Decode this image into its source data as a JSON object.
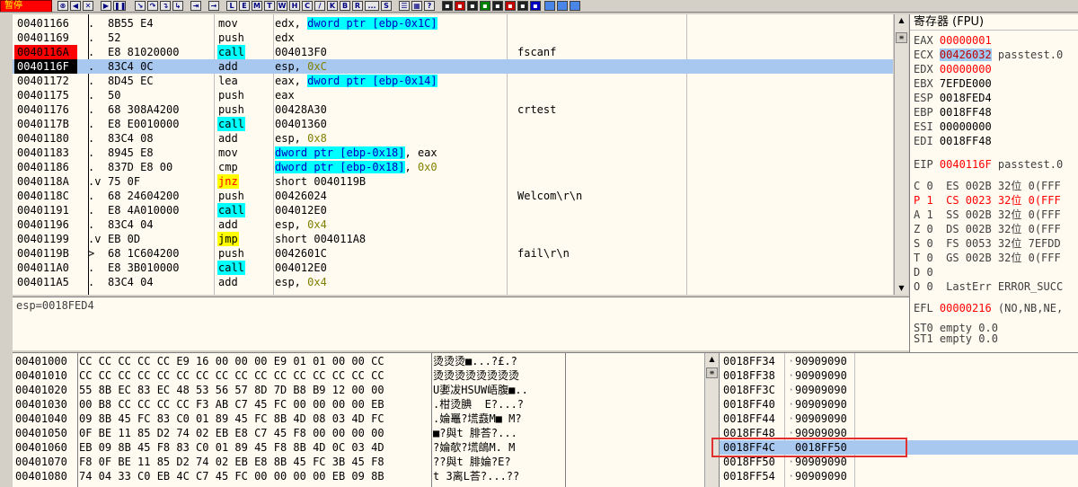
{
  "toolbar": {
    "status": "暂停",
    "buttons": [
      "L",
      "E",
      "M",
      "T",
      "W",
      "H",
      "C",
      "/",
      "K",
      "B",
      "R",
      "...",
      "S"
    ]
  },
  "disasm": {
    "rows": [
      {
        "addr": "00401166",
        "mark": ".",
        "hex": "8B55 E4",
        "mn": "mov",
        "op": "edx, dword ptr [ebp-0x1C]",
        "cm": "",
        "style": ""
      },
      {
        "addr": "00401169",
        "mark": ".",
        "hex": "52",
        "mn": "push",
        "op": "edx",
        "cm": "",
        "style": ""
      },
      {
        "addr": "0040116A",
        "mark": ".",
        "hex": "E8 81020000",
        "mn": "call",
        "op": "004013F0",
        "cm": "fscanf",
        "style": "bp"
      },
      {
        "addr": "0040116F",
        "mark": ".",
        "hex": "83C4 0C",
        "mn": "add",
        "op": "esp, 0xC",
        "cm": "",
        "style": "cur"
      },
      {
        "addr": "00401172",
        "mark": ".",
        "hex": "8D45 EC",
        "mn": "lea",
        "op": "eax, dword ptr [ebp-0x14]",
        "cm": "",
        "style": ""
      },
      {
        "addr": "00401175",
        "mark": ".",
        "hex": "50",
        "mn": "push",
        "op": "eax",
        "cm": "",
        "style": ""
      },
      {
        "addr": "00401176",
        "mark": ".",
        "hex": "68 308A4200",
        "mn": "push",
        "op": "00428A30",
        "cm": "crtest",
        "style": ""
      },
      {
        "addr": "0040117B",
        "mark": ".",
        "hex": "E8 E0010000",
        "mn": "call",
        "op": "00401360",
        "cm": "",
        "style": ""
      },
      {
        "addr": "00401180",
        "mark": ".",
        "hex": "83C4 08",
        "mn": "add",
        "op": "esp, 0x8",
        "cm": "",
        "style": ""
      },
      {
        "addr": "00401183",
        "mark": ".",
        "hex": "8945 E8",
        "mn": "mov",
        "op": "dword ptr [ebp-0x18], eax",
        "cm": "",
        "style": ""
      },
      {
        "addr": "00401186",
        "mark": ".",
        "hex": "837D E8 00",
        "mn": "cmp",
        "op": "dword ptr [ebp-0x18], 0x0",
        "cm": "",
        "style": ""
      },
      {
        "addr": "0040118A",
        "mark": ".v",
        "hex": "75 0F",
        "mn": "jnz",
        "op": "short 0040119B",
        "cm": "",
        "style": ""
      },
      {
        "addr": "0040118C",
        "mark": ".",
        "hex": "68 24604200",
        "mn": "push",
        "op": "00426024",
        "cm": "Welcom\\r\\n",
        "style": ""
      },
      {
        "addr": "00401191",
        "mark": ".",
        "hex": "E8 4A010000",
        "mn": "call",
        "op": "004012E0",
        "cm": "",
        "style": ""
      },
      {
        "addr": "00401196",
        "mark": ".",
        "hex": "83C4 04",
        "mn": "add",
        "op": "esp, 0x4",
        "cm": "",
        "style": ""
      },
      {
        "addr": "00401199",
        "mark": ".v",
        "hex": "EB 0D",
        "mn": "jmp",
        "op": "short 004011A8",
        "cm": "",
        "style": ""
      },
      {
        "addr": "0040119B",
        "mark": ">",
        "hex": "68 1C604200",
        "mn": "push",
        "op": "0042601C",
        "cm": "fail\\r\\n",
        "style": ""
      },
      {
        "addr": "004011A0",
        "mark": ".",
        "hex": "E8 3B010000",
        "mn": "call",
        "op": "004012E0",
        "cm": "",
        "style": ""
      },
      {
        "addr": "004011A5",
        "mark": ".",
        "hex": "83C4 04",
        "mn": "add",
        "op": "esp, 0x4",
        "cm": "",
        "style": ""
      }
    ]
  },
  "info": {
    "text": "esp=0018FED4"
  },
  "registers": {
    "title": "寄存器 (FPU)",
    "general": [
      {
        "name": "EAX",
        "value": "00000001",
        "extra": "",
        "changed": true
      },
      {
        "name": "ECX",
        "value": "00426032",
        "extra": "passtest.0",
        "changed": true
      },
      {
        "name": "EDX",
        "value": "00000000",
        "extra": "",
        "changed": true
      },
      {
        "name": "EBX",
        "value": "7EFDE000",
        "extra": "",
        "changed": false
      },
      {
        "name": "ESP",
        "value": "0018FED4",
        "extra": "",
        "changed": false
      },
      {
        "name": "EBP",
        "value": "0018FF48",
        "extra": "",
        "changed": false
      },
      {
        "name": "ESI",
        "value": "00000000",
        "extra": "",
        "changed": false
      },
      {
        "name": "EDI",
        "value": "0018FF48",
        "extra": "",
        "changed": false
      }
    ],
    "eip": {
      "name": "EIP",
      "value": "0040116F",
      "extra": "passtest.0"
    },
    "flags": [
      "C 0  ES 002B 32位 0(FFF",
      "P 1  CS 0023 32位 0(FFF",
      "A 1  SS 002B 32位 0(FFF",
      "Z 0  DS 002B 32位 0(FFF",
      "S 0  FS 0053 32位 7EFDD",
      "T 0  GS 002B 32位 0(FFF",
      "D 0",
      "O 0  LastErr ERROR_SUCC"
    ],
    "efl": {
      "name": "EFL",
      "value": "00000216",
      "extra": "(NO,NB,NE,"
    },
    "st": [
      "ST0 empty 0.0",
      "ST1 empty 0.0"
    ]
  },
  "dump": {
    "rows": [
      {
        "addr": "00401000",
        "hex": "CC CC CC CC CC E9 16 00 00 00 E9 01 01 00 00 CC",
        "ascii": "烫烫烫■...?£.?"
      },
      {
        "addr": "00401010",
        "hex": "CC CC CC CC CC CC CC CC CC CC CC CC CC CC CC CC",
        "ascii": "烫烫烫烫烫烫烫烫"
      },
      {
        "addr": "00401020",
        "hex": "55 8B EC 83 EC 48 53 56 57 8D 7D B8 B9 12 00 00",
        "ascii": "U嬱冹HSUW峿腹■.."
      },
      {
        "addr": "00401030",
        "hex": "00 B8 CC CC CC CC F3 AB C7 45 FC 00 00 00 00 EB",
        "ascii": ".柑烫腆  E?...?"
      },
      {
        "addr": "00401040",
        "hex": "09 8B 45 FC 83 C0 01 89 45 FC 8B 4D 08 03 4D FC",
        "ascii": ".婨鼉?塃鼖M■ M?"
      },
      {
        "addr": "00401050",
        "hex": "0F BE 11 85 D2 74 02 EB E8 C7 45 F8 00 00 00 00",
        "ascii": "■?與t 腓荅?..."
      },
      {
        "addr": "00401060",
        "hex": "EB 09 8B 45 F8 83 C0 01 89 45 F8 8B 4D 0C 03 4D",
        "ascii": "?婨欹?塃鴭M. M"
      },
      {
        "addr": "00401070",
        "hex": "F8 0F BE 11 85 D2 74 02 EB E8 8B 45 FC 3B 45 F8",
        "ascii": "??與t 腓婨?E?"
      },
      {
        "addr": "00401080",
        "hex": "74 04 33 C0 EB 4C C7 45 FC 00 00 00 00 EB 09 8B",
        "ascii": "t 3离L荅?...??"
      }
    ]
  },
  "stack": {
    "rows": [
      {
        "addr": "0018FF34",
        "value": "90909090"
      },
      {
        "addr": "0018FF38",
        "value": "90909090"
      },
      {
        "addr": "0018FF3C",
        "value": "90909090"
      },
      {
        "addr": "0018FF40",
        "value": "90909090"
      },
      {
        "addr": "0018FF44",
        "value": "90909090"
      },
      {
        "addr": "0018FF48",
        "value": "90909090"
      },
      {
        "addr": "0018FF4C",
        "value": "0018FF50"
      },
      {
        "addr": "0018FF50",
        "value": "90909090"
      },
      {
        "addr": "0018FF54",
        "value": "90909090"
      }
    ]
  }
}
